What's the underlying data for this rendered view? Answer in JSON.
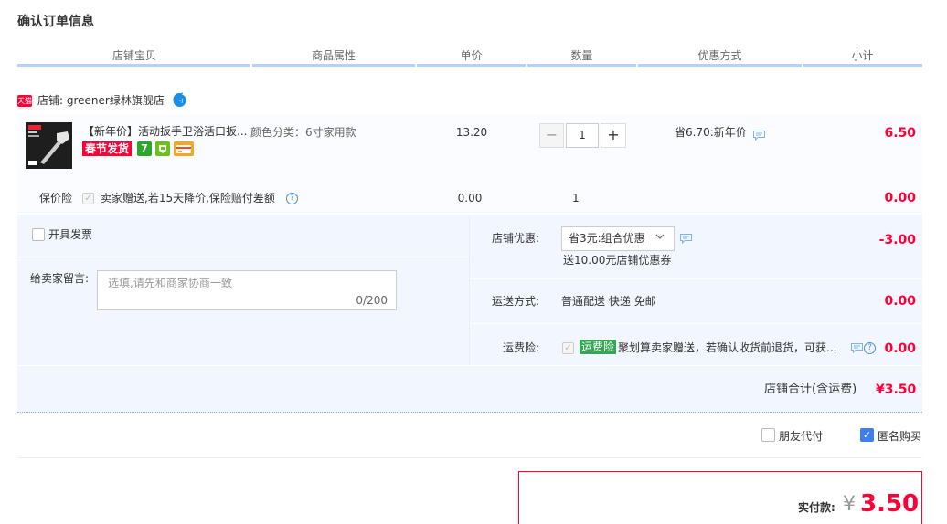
{
  "page": {
    "title": "确认订单信息"
  },
  "columns": [
    "店铺宝贝",
    "商品属性",
    "单价",
    "数量",
    "优惠方式",
    "小计"
  ],
  "store": {
    "badge": "天猫",
    "label": "店铺: greener绿林旗舰店"
  },
  "item": {
    "title": "【新年价】活动扳手卫浴活口扳...",
    "attribute": "颜色分类：6寸家用款",
    "tag_spring": "春节发货",
    "tag_seven": "7",
    "price": "13.20",
    "quantity": "1",
    "qty_minus": "−",
    "qty_plus": "+",
    "discount": "省6.70:新年价",
    "subtotal": "6.50"
  },
  "insurance": {
    "label": "保价险",
    "desc": "卖家赠送,若15天降价,保险赔付差额",
    "price": "0.00",
    "quantity": "1",
    "subtotal": "0.00"
  },
  "invoice": {
    "label": "开具发票"
  },
  "message": {
    "label": "给卖家留言:",
    "placeholder": "选填,请先和商家协商一致",
    "count": "0/200"
  },
  "store_discount": {
    "label": "店铺优惠:",
    "selected": "省3元:组合优惠",
    "coupon": "送10.00元店铺优惠券",
    "amount": "-3.00"
  },
  "shipping": {
    "label": "运送方式:",
    "value": "普通配送 快递 免邮",
    "amount": "0.00"
  },
  "freight_insurance": {
    "label": "运费险:",
    "tag": "运费险",
    "desc": "聚划算卖家赠送，若确认收货前退货，可获...",
    "amount": "0.00"
  },
  "store_total": {
    "label": "店铺合计(含运费)",
    "amount": "¥3.50"
  },
  "options": {
    "friend_pay": "朋友代付",
    "anonymous": "匿名购买"
  },
  "payment": {
    "label": "实付款:",
    "currency": "¥",
    "amount": "3.50"
  },
  "colors": {
    "accent_red": "#ff0036",
    "header_underline": "#b2d1ff",
    "panel_bg": "#f2f7ff",
    "checkbox_blue": "#3d7ef7"
  }
}
